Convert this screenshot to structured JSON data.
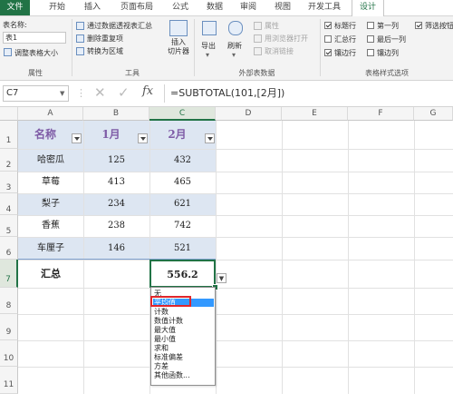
{
  "tabs": [
    "文件",
    "开始",
    "插入",
    "页面布局",
    "公式",
    "数据",
    "审阅",
    "视图",
    "开发工具",
    "设计"
  ],
  "ribbon": {
    "props": {
      "table_name_label": "表名称:",
      "table_name_value": "表1",
      "resize_label": "调整表格大小",
      "group_label": "属性"
    },
    "tools": {
      "pivot": "通过数据透视表汇总",
      "dedup": "删除重复项",
      "convert": "转换为区域",
      "slicer": "插入\n切片器",
      "group_label": "工具"
    },
    "external": {
      "export": "导出",
      "refresh": "刷新",
      "properties": "属性",
      "open_browser": "用浏览器打开",
      "unlink": "取消链接",
      "group_label": "外部表数据"
    },
    "style_options": {
      "header_row": "标题行",
      "total_row": "汇总行",
      "banded_rows": "镶边行",
      "first_col": "第一列",
      "last_col": "最后一列",
      "banded_cols": "镶边列",
      "filter_btn": "筛选按钮",
      "group_label": "表格样式选项"
    }
  },
  "formula_bar": {
    "name_box": "C7",
    "formula": "=SUBTOTAL(101,[2月])"
  },
  "grid": {
    "columns": [
      "A",
      "B",
      "C",
      "D",
      "E",
      "F",
      "G"
    ],
    "rows": [
      "1",
      "2",
      "3",
      "4",
      "5",
      "6",
      "7",
      "8",
      "9",
      "10",
      "11"
    ],
    "headers": [
      "名称",
      "1月",
      "2月"
    ],
    "data": [
      [
        "哈密瓜",
        "125",
        "432"
      ],
      [
        "草莓",
        "413",
        "465"
      ],
      [
        "梨子",
        "234",
        "621"
      ],
      [
        "香蕉",
        "238",
        "742"
      ],
      [
        "车厘子",
        "146",
        "521"
      ]
    ],
    "total_label": "汇总",
    "total_value": "556.2"
  },
  "dropdown": {
    "options": [
      "无",
      "平均值",
      "计数",
      "数值计数",
      "最大值",
      "最小值",
      "求和",
      "标准偏差",
      "方差",
      "其他函数..."
    ],
    "selected": "平均值"
  },
  "colors": {
    "accent": "#217346",
    "band": "#dde6f2",
    "highlight": "#3399ff",
    "header_text": "#7e5ba6"
  }
}
